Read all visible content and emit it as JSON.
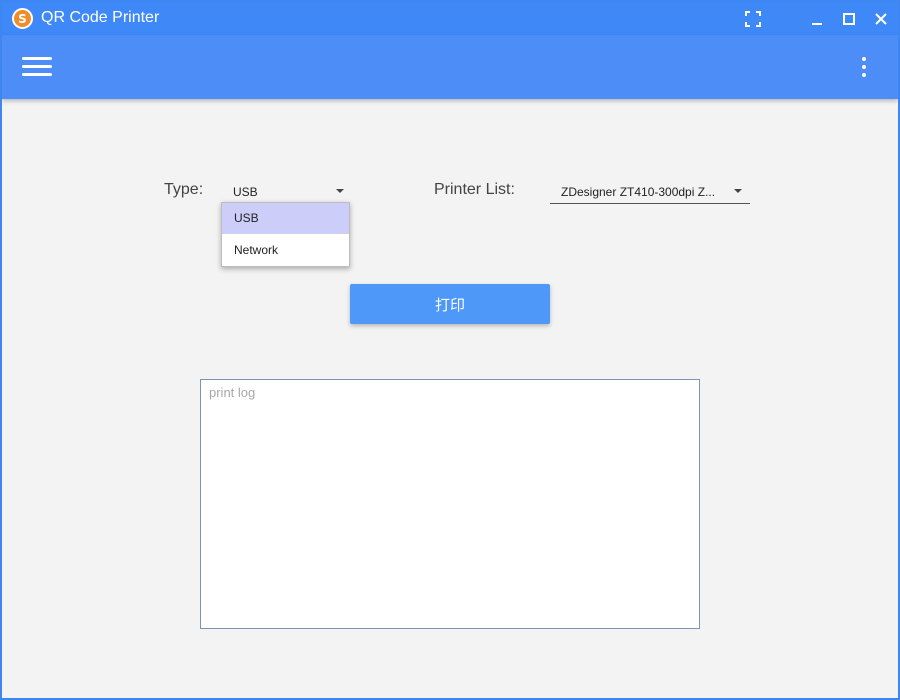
{
  "window": {
    "title": "QR Code Printer",
    "logo_letter": "S",
    "controls": [
      "fullscreen-icon",
      "minimize-icon",
      "maximize-icon",
      "close-icon"
    ]
  },
  "appbar": {
    "menu_icon": "hamburger-menu-icon",
    "more_icon": "more-vert-icon"
  },
  "form": {
    "type_label": "Type:",
    "type_selected": "USB",
    "type_options": [
      "USB",
      "Network"
    ],
    "type_highlighted": "USB",
    "printer_label": "Printer List:",
    "printer_selected": "ZDesigner ZT410-300dpi Z..."
  },
  "print_button": {
    "label": "打印"
  },
  "log": {
    "value": "",
    "placeholder": "print log"
  },
  "colors": {
    "titlebar": "#3e88f7",
    "appbar": "#4c8df7",
    "button": "#4e98fa",
    "background": "#f3f3f3",
    "highlight": "#cdcdfa",
    "logo": "#f28c28"
  }
}
